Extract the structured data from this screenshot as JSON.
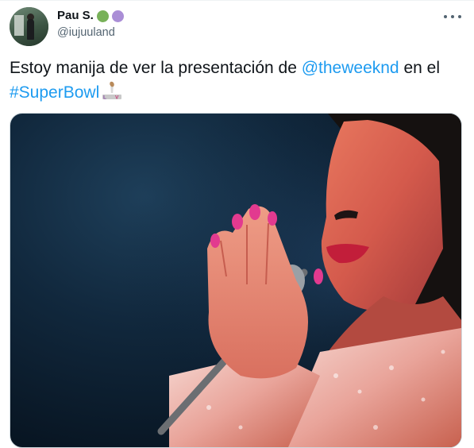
{
  "tweet": {
    "author": {
      "display_name": "Pau S.",
      "name_emojis": [
        {
          "icon": "green-circle-emoji",
          "color": "#78b159"
        },
        {
          "icon": "purple-circle-emoji",
          "color": "#aa8ed6"
        }
      ],
      "handle": "@iujuuland"
    },
    "text_parts": {
      "before_mention": "Estoy manija de ver la presentación de ",
      "mention": "@theweeknd",
      "after_mention": " en el ",
      "hashtag": "#SuperBowl"
    },
    "hashtag_icon": "super-bowl-lv-logo-icon",
    "media": {
      "type": "photo"
    },
    "menu_icon": "more-options-icon"
  },
  "colors": {
    "link": "#1d9bf0",
    "text": "#0f1419",
    "secondary_text": "#536471"
  }
}
